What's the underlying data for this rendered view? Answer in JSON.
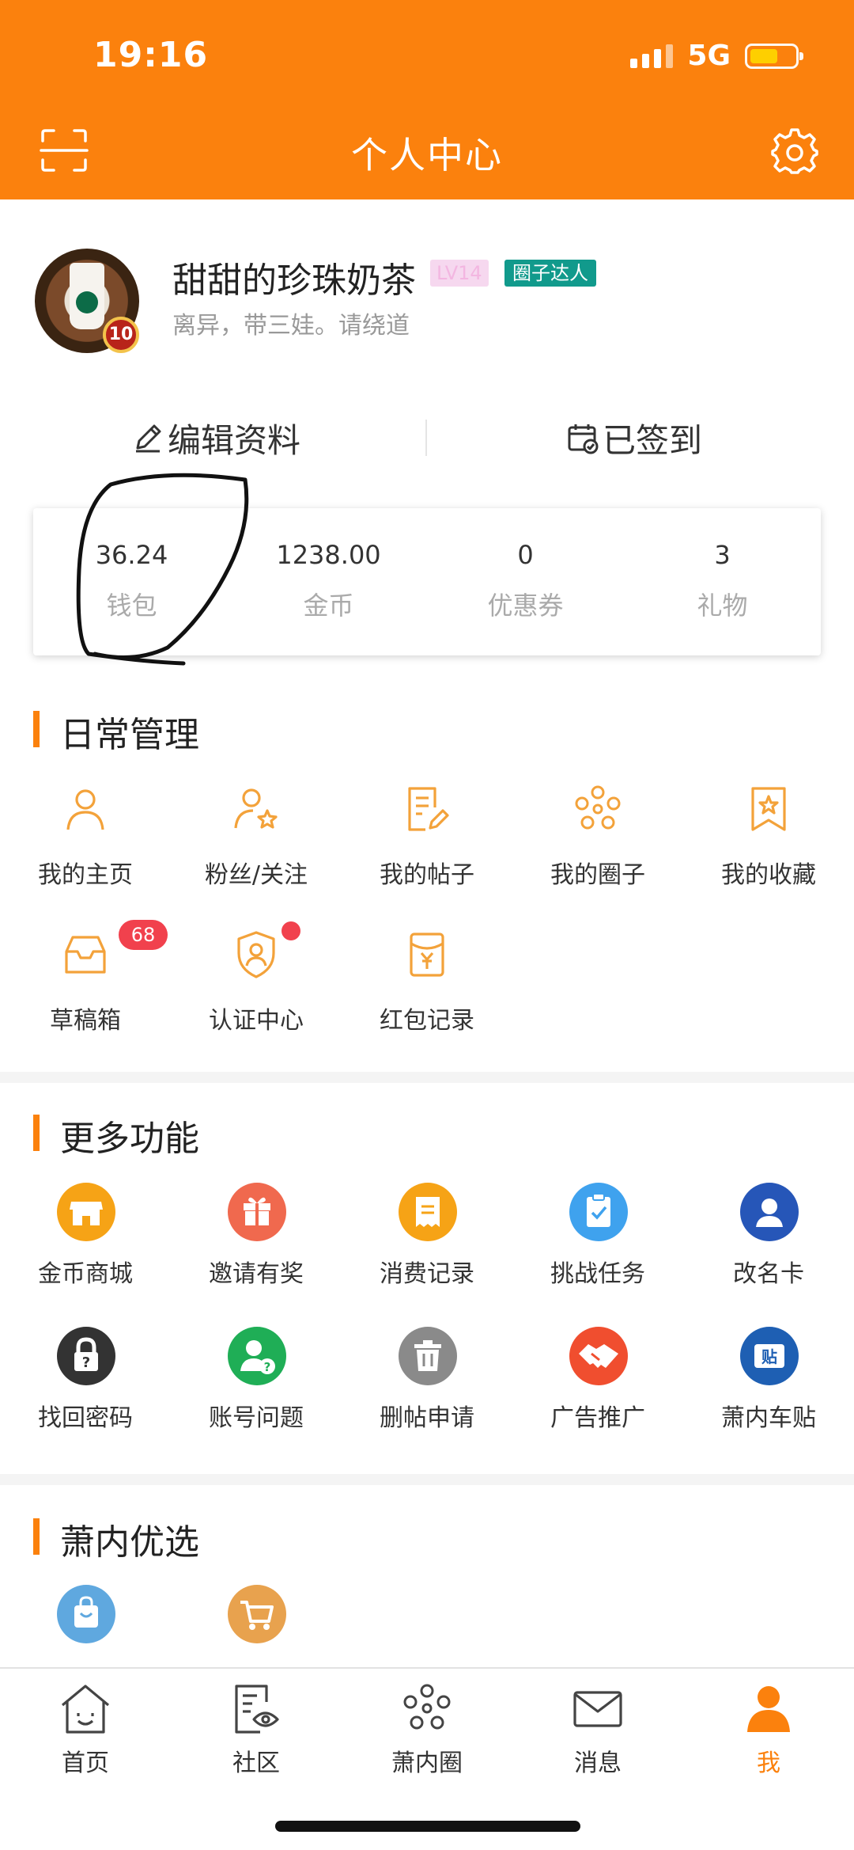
{
  "status_bar": {
    "time": "19:16",
    "network": "5G",
    "battery_level": 0.55
  },
  "header": {
    "title": "个人中心",
    "scan_icon": "scan-icon",
    "settings_icon": "gear-icon"
  },
  "profile": {
    "username": "甜甜的珍珠奶茶",
    "level_badge": "LV14",
    "circle_badge": "圈子达人",
    "bio": "离异，带三娃。请绕道",
    "avatar_level": "10"
  },
  "actions": {
    "edit_label": "编辑资料",
    "sign_label": "已签到"
  },
  "wallet": [
    {
      "value": "36.24",
      "label": "钱包"
    },
    {
      "value": "1238.00",
      "label": "金币"
    },
    {
      "value": "0",
      "label": "优惠券"
    },
    {
      "value": "3",
      "label": "礼物"
    }
  ],
  "daily": {
    "title": "日常管理",
    "items": [
      {
        "label": "我的主页",
        "icon": "user-icon"
      },
      {
        "label": "粉丝/关注",
        "icon": "user-star-icon"
      },
      {
        "label": "我的帖子",
        "icon": "post-edit-icon"
      },
      {
        "label": "我的圈子",
        "icon": "flower-circle-icon"
      },
      {
        "label": "我的收藏",
        "icon": "bookmark-star-icon"
      },
      {
        "label": "草稿箱",
        "icon": "inbox-icon",
        "badge": "68"
      },
      {
        "label": "认证中心",
        "icon": "shield-user-icon",
        "dot": true
      },
      {
        "label": "红包记录",
        "icon": "red-packet-icon"
      }
    ]
  },
  "more": {
    "title": "更多功能",
    "items": [
      {
        "label": "金币商城",
        "icon": "shop-icon",
        "color": "#f6a316"
      },
      {
        "label": "邀请有奖",
        "icon": "gift-icon",
        "color": "#f0694e"
      },
      {
        "label": "消费记录",
        "icon": "receipt-icon",
        "color": "#f6a316"
      },
      {
        "label": "挑战任务",
        "icon": "task-clipboard-icon",
        "color": "#3fa2ee"
      },
      {
        "label": "改名卡",
        "icon": "profile-card-icon",
        "color": "#2656b8"
      },
      {
        "label": "找回密码",
        "icon": "lock-icon",
        "color": "#333333"
      },
      {
        "label": "账号问题",
        "icon": "user-question-icon",
        "color": "#1fae56"
      },
      {
        "label": "删帖申请",
        "icon": "trash-icon",
        "color": "#8a8a8a"
      },
      {
        "label": "广告推广",
        "icon": "handshake-icon",
        "color": "#f04e2f"
      },
      {
        "label": "萧内车贴",
        "icon": "sticker-icon",
        "color": "#1e5fb3",
        "glyph": "贴"
      }
    ]
  },
  "featured": {
    "title": "萧内优选",
    "items": [
      {
        "icon": "shopping-bag-icon",
        "color": "#5fa8df"
      },
      {
        "icon": "shopping-cart-icon",
        "color": "#e8a24e"
      }
    ]
  },
  "bottom_nav": [
    {
      "label": "首页",
      "icon": "home-icon"
    },
    {
      "label": "社区",
      "icon": "community-icon"
    },
    {
      "label": "萧内圈",
      "icon": "flower-circle-icon"
    },
    {
      "label": "消息",
      "icon": "mail-icon"
    },
    {
      "label": "我",
      "icon": "person-icon",
      "active": true
    }
  ],
  "colors": {
    "accent": "#fb810d",
    "badge_red": "#f1414d"
  }
}
